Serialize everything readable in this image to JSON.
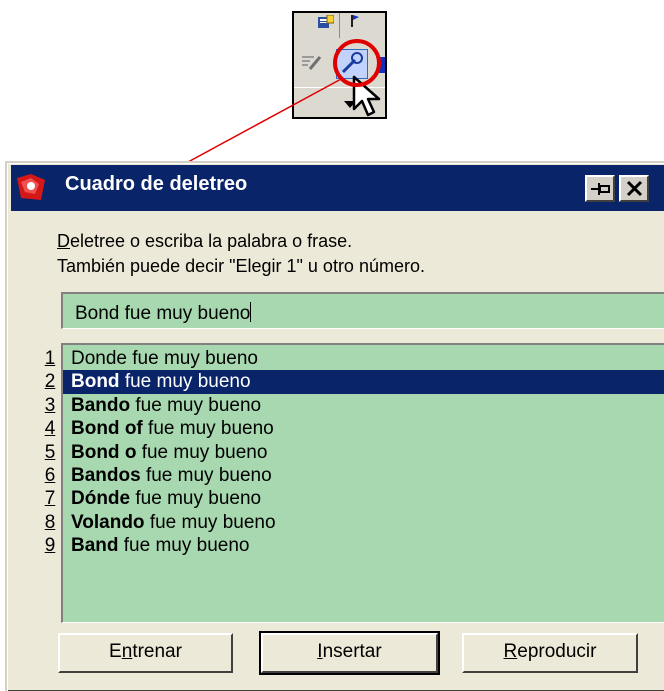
{
  "dialog": {
    "title": "Cuadro de deletreo",
    "instructions": {
      "line1_mnemonic": "D",
      "line1_rest": "eletree o escriba la palabra o frase.",
      "line2": "También puede decir \"Elegir 1\" u otro número."
    },
    "input_value": "Bond fue muy bueno",
    "candidates": [
      {
        "number": "1",
        "bold": "",
        "rest": "Donde fue muy bueno"
      },
      {
        "number": "2",
        "bold": "Bond",
        "rest": " fue muy bueno"
      },
      {
        "number": "3",
        "bold": "Bando",
        "rest": " fue muy bueno"
      },
      {
        "number": "4",
        "bold": "Bond of",
        "rest": " fue muy bueno"
      },
      {
        "number": "5",
        "bold": "Bond o",
        "rest": " fue muy bueno"
      },
      {
        "number": "6",
        "bold": "Bandos",
        "rest": " fue muy bueno"
      },
      {
        "number": "7",
        "bold": "Dónde",
        "rest": " fue muy bueno"
      },
      {
        "number": "8",
        "bold": "Volando",
        "rest": " fue muy bueno"
      },
      {
        "number": "9",
        "bold": "Band",
        "rest": " fue muy bueno"
      }
    ],
    "selected_index": 1,
    "buttons": {
      "train": {
        "pre": "E",
        "mnemonic": "n",
        "post": "trenar"
      },
      "insert": {
        "pre": "",
        "mnemonic": "I",
        "post": "nsertar"
      },
      "play": {
        "pre": "",
        "mnemonic": "R",
        "post": "eproducir"
      }
    }
  },
  "icons": [
    "toolbar-doc-icon",
    "toolbar-flag-icon",
    "toolbar-pencil-icon",
    "spelling-tool-icon",
    "dropdown-arrow-icon",
    "mouse-cursor-icon",
    "app-icon",
    "pin-icon",
    "close-icon"
  ],
  "colors": {
    "title_bar": "#0a246a",
    "list_background": "#a8d8b0",
    "selection": "#0a246a",
    "annotation": "#e00000",
    "dialog_face": "#ece9d8"
  }
}
